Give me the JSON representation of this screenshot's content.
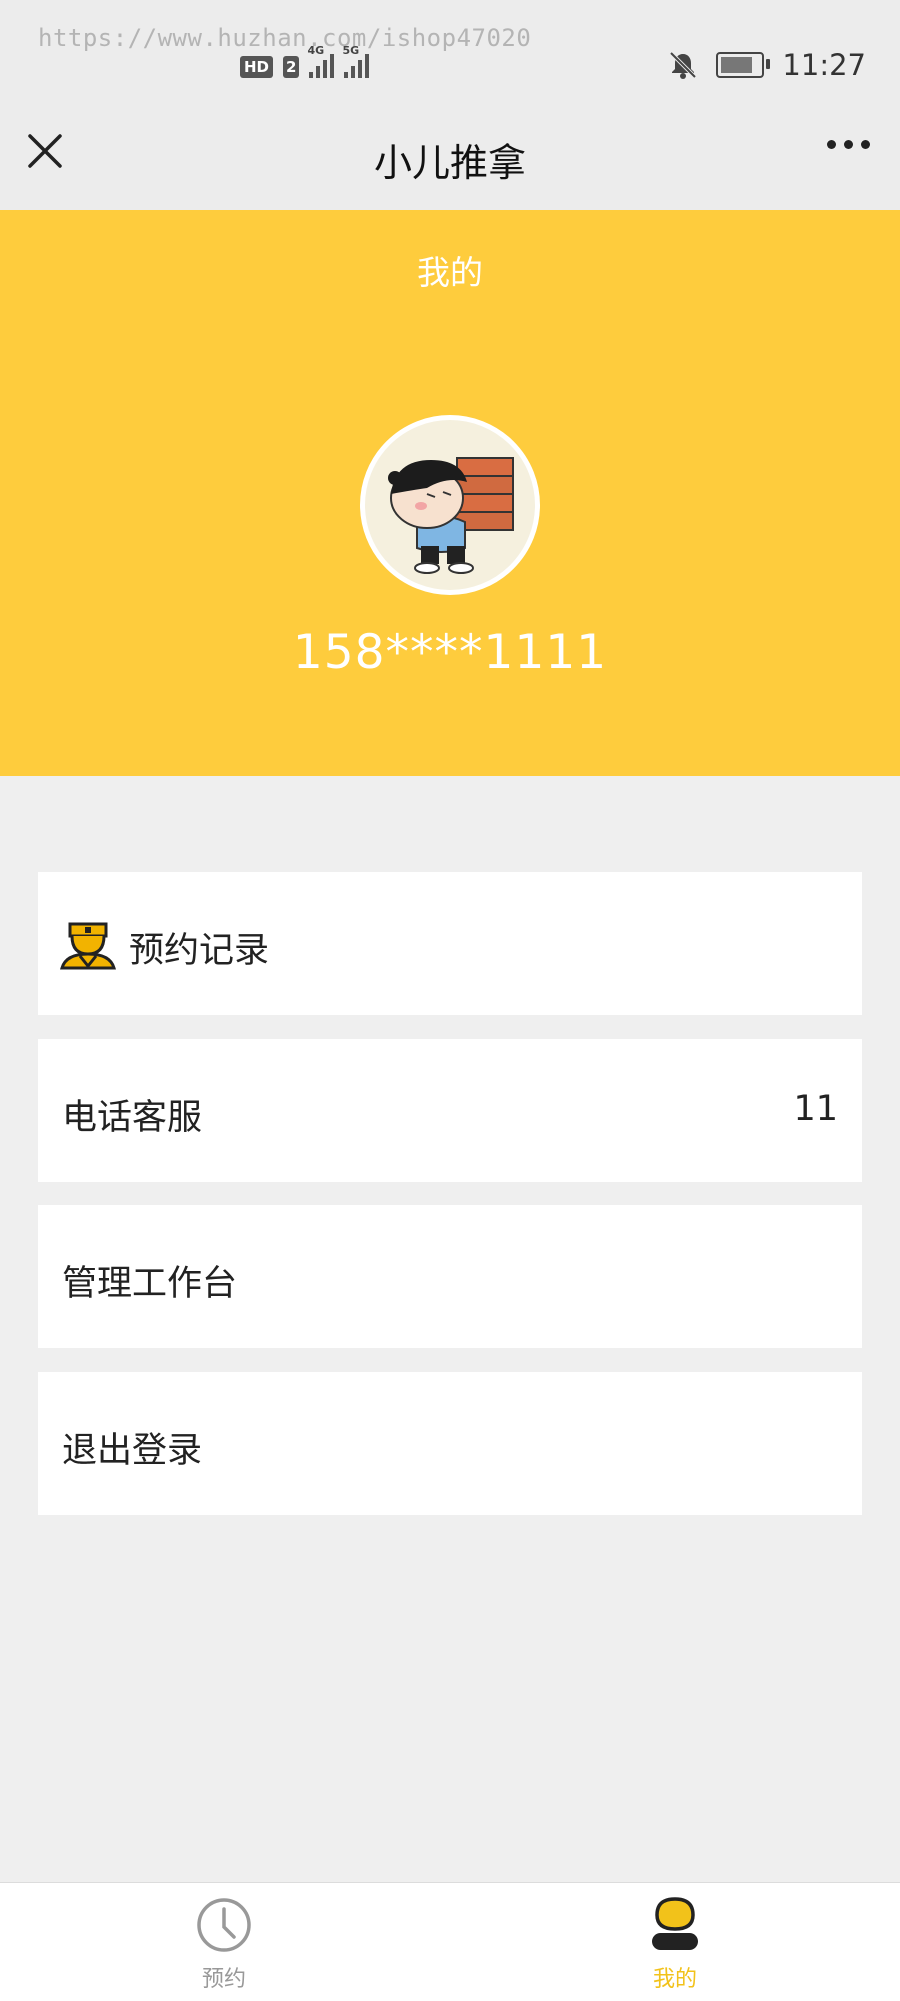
{
  "status_bar": {
    "watermark": "https://www.huzhan.com/ishop47020",
    "hd_badge": "HD",
    "sim_badge": "2",
    "network_1": "4G",
    "network_2": "5G",
    "time": "11:27",
    "icons": [
      "notifications-off-icon",
      "battery-charging-icon",
      "signal-icon"
    ]
  },
  "nav": {
    "title": "小儿推拿",
    "icons": [
      "close-icon",
      "more-icon"
    ]
  },
  "header": {
    "title": "我的",
    "phone": "158****1111",
    "background_color": "#fecc3d"
  },
  "menu": {
    "items": [
      {
        "label": "预约记录",
        "icon": "doctor-icon",
        "value": ""
      },
      {
        "label": "电话客服",
        "value": "11"
      },
      {
        "label": "管理工作台",
        "value": ""
      },
      {
        "label": "退出登录",
        "value": ""
      }
    ]
  },
  "tabbar": {
    "tabs": [
      {
        "label": "预约",
        "icon": "clock-icon",
        "active": false
      },
      {
        "label": "我的",
        "icon": "user-icon",
        "active": true
      }
    ],
    "active_color": "#f2c21a",
    "inactive_color": "#999999"
  }
}
